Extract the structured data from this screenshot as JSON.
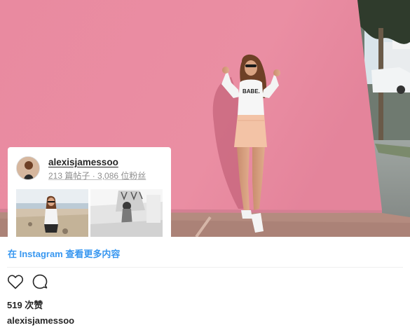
{
  "post": {
    "image_alt": "Woman in a white BABE. long-sleeve top and peach mini skirt posing in front of a pink wall",
    "shirt_text": "BABE."
  },
  "profile_card": {
    "username": "alexisjamessoo",
    "stats": "213 篇帖子 · 3,086 位粉丝"
  },
  "view_more_link": "在 Instagram 查看更多内容",
  "likes_text": "519 次赞",
  "caption_username": "alexisjamessoo",
  "colors": {
    "link_blue": "#3897f0",
    "wall_pink": "#e88aa0",
    "text_dark": "#262626",
    "text_muted": "#8e8e8e"
  },
  "icons": {
    "like": "heart-outline-icon",
    "comment": "speech-bubble-icon"
  }
}
